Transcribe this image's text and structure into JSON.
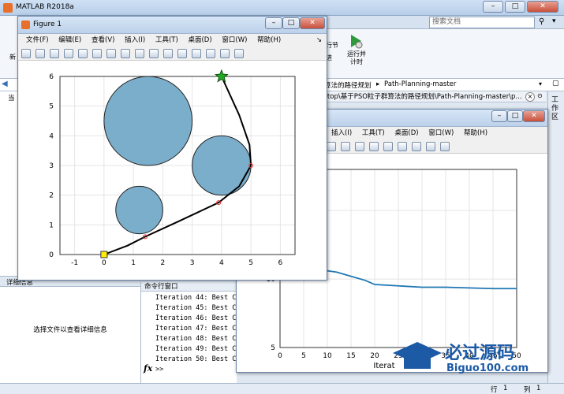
{
  "app": {
    "title": "MATLAB R2018a",
    "search_placeholder": "搜索文档"
  },
  "ribbon": {
    "run_section_label": "行节",
    "run_time_label": "运行并\n计时",
    "run_label": "运行并\n计时",
    "left_label": "新",
    "left_label2": "进"
  },
  "addressbar": {
    "path_part1": "算法的路径规划",
    "path_part2": "Path-Planning-master"
  },
  "pathbar": {
    "text": "ktop\\基于PSO粒子群算法的路径规划\\Path-Planning-master\\p..."
  },
  "left_panel": {
    "header_partial": "当",
    "details_title": "详细信息",
    "details_message": "选择文件以查看详细信息"
  },
  "workspace_label": "工作区",
  "command_window": {
    "title": "命令行窗口",
    "lines": [
      "Iteration 44: Best Co",
      "Iteration 45: Best Co",
      "Iteration 46: Best Co",
      "Iteration 47: Best Co",
      "Iteration 48: Best Co",
      "Iteration 49: Best Co",
      "Iteration 50: Best Co"
    ],
    "prompt": ">>"
  },
  "status": {
    "row_label": "行",
    "row_value": "1",
    "col_label": "列",
    "col_value": "1"
  },
  "figure1": {
    "title": "Figure 1",
    "menus": [
      "文件(F)",
      "编辑(E)",
      "查看(V)",
      "插入(I)",
      "工具(T)",
      "桌面(D)",
      "窗口(W)",
      "帮助(H)"
    ],
    "xticks": [
      "-1",
      "0",
      "1",
      "2",
      "3",
      "4",
      "5",
      "6"
    ],
    "yticks": [
      "0",
      "1",
      "2",
      "3",
      "4",
      "5",
      "6"
    ]
  },
  "figure2": {
    "menus": [
      "插入(I)",
      "工具(T)",
      "桌面(D)",
      "窗口(W)",
      "帮助(H)"
    ],
    "yticks": [
      "5",
      "10",
      "15"
    ],
    "xticks": [
      "0",
      "5",
      "10",
      "15",
      "20",
      "25",
      "30",
      "35",
      "40",
      "45",
      "50"
    ],
    "xlabel": "Iterat"
  },
  "watermark": {
    "text": "必过源码",
    "url": "Biguo100.com"
  },
  "chart_data": [
    {
      "type": "scatter",
      "xlim": [
        -1.5,
        6.5
      ],
      "ylim": [
        0,
        6
      ],
      "grid": true,
      "obstacles": [
        {
          "cx": 1.5,
          "cy": 4.5,
          "r": 1.5
        },
        {
          "cx": 4.0,
          "cy": 3.0,
          "r": 1.0
        },
        {
          "cx": 1.2,
          "cy": 1.5,
          "r": 0.8
        }
      ],
      "path": [
        [
          0,
          0
        ],
        [
          0.8,
          0.3
        ],
        [
          1.4,
          0.6
        ],
        [
          2.5,
          1.1
        ],
        [
          3.9,
          1.75
        ],
        [
          4.6,
          2.3
        ],
        [
          5.0,
          3.0
        ],
        [
          4.95,
          3.7
        ],
        [
          4.6,
          4.7
        ],
        [
          4.0,
          6.0
        ]
      ],
      "waypoints": [
        [
          1.4,
          0.6
        ],
        [
          3.9,
          1.75
        ],
        [
          5.0,
          3.0
        ]
      ],
      "start": [
        0,
        0
      ],
      "goal": [
        4,
        6
      ],
      "obstacle_color": "#7aaecb",
      "path_color": "#000000",
      "waypoint_color": "#e03030",
      "start_color": "#ffee00",
      "goal_color": "#22aa22"
    },
    {
      "type": "line",
      "xlim": [
        0,
        50
      ],
      "ylim": [
        5,
        18
      ],
      "grid": true,
      "x": [
        0,
        1,
        2,
        3,
        4,
        5,
        6,
        8,
        10,
        12,
        15,
        18,
        20,
        25,
        30,
        35,
        40,
        45,
        50
      ],
      "y": [
        17.5,
        14.2,
        12.9,
        12.1,
        11.6,
        11.2,
        10.9,
        10.7,
        10.6,
        10.5,
        10.2,
        9.9,
        9.6,
        9.5,
        9.4,
        9.4,
        9.35,
        9.3,
        9.3
      ],
      "color": "#1f77b4"
    }
  ]
}
